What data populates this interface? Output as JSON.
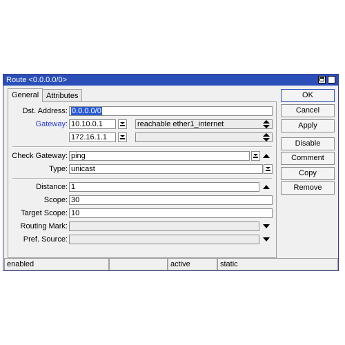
{
  "window": {
    "title": "Route <0.0.0.0/0>"
  },
  "tabs": [
    {
      "label": "General"
    },
    {
      "label": "Attributes"
    }
  ],
  "fields": {
    "dst_address": {
      "label": "Dst. Address:",
      "value": "0.0.0.0/0"
    },
    "gateway": {
      "label": "Gateway:",
      "values": [
        "10.10.0.1",
        "172.16.1.1"
      ],
      "statuses": [
        "reachable ether1_internet",
        ""
      ]
    },
    "check_gateway": {
      "label": "Check Gateway:",
      "value": "ping"
    },
    "type": {
      "label": "Type:",
      "value": "unicast"
    },
    "distance": {
      "label": "Distance:",
      "value": "1"
    },
    "scope": {
      "label": "Scope:",
      "value": "30"
    },
    "target_scope": {
      "label": "Target Scope:",
      "value": "10"
    },
    "routing_mark": {
      "label": "Routing Mark:",
      "value": ""
    },
    "pref_source": {
      "label": "Pref. Source:",
      "value": ""
    }
  },
  "buttons": {
    "ok": "OK",
    "cancel": "Cancel",
    "apply": "Apply",
    "disable": "Disable",
    "comment": "Comment",
    "copy": "Copy",
    "remove": "Remove"
  },
  "status": [
    "enabled",
    "",
    "active",
    "static"
  ],
  "colors": {
    "titlebar": "#2b4fb8",
    "link_label": "#2a3bd6",
    "selection": "#2a5bd7"
  }
}
